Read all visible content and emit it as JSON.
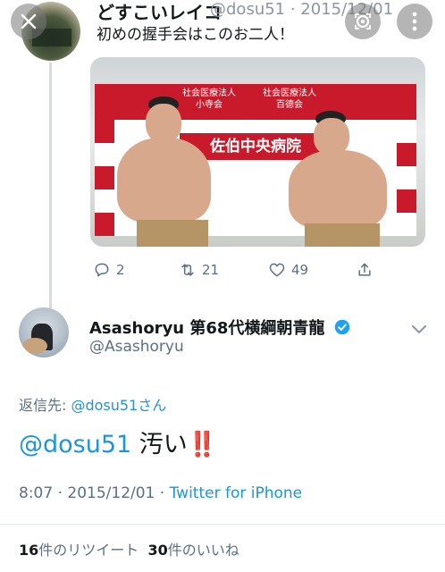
{
  "tweet1": {
    "name": "どすこいレイコ",
    "handle": "@dosu51 · 2015/12/01",
    "text": "初めの握手会はこのお二人！",
    "photo_signs": {
      "org1": "社会医療法人",
      "org1b": "小寺会",
      "org2": "社会医療法人",
      "org2b": "百德会",
      "hospital": "佐伯中央病院"
    },
    "actions": {
      "replies": "2",
      "retweets": "21",
      "likes": "49"
    }
  },
  "tweet2": {
    "name": "Asashoryu 第68代横綱朝青龍",
    "handle": "@Asashoryu",
    "replying_label": "返信先: ",
    "replying_to": "@dosu51さん",
    "mention": "@dosu51",
    "text": " 汚い",
    "emphasis": "‼️",
    "timestamp": "8:07 · 2015/12/01 · ",
    "source": "Twitter for iPhone",
    "retweet_count": "16",
    "retweet_label": "件のリツイート",
    "like_count": "30",
    "like_label": "件のいいね"
  },
  "colors": {
    "link": "#1b95e0",
    "muted": "#5b7083",
    "verified": "#1da1f2"
  },
  "icons": [
    "close-icon",
    "more-icon",
    "search-icon",
    "reply-icon",
    "retweet-icon",
    "like-icon",
    "share-icon",
    "verified-icon",
    "chevron-down-icon"
  ]
}
